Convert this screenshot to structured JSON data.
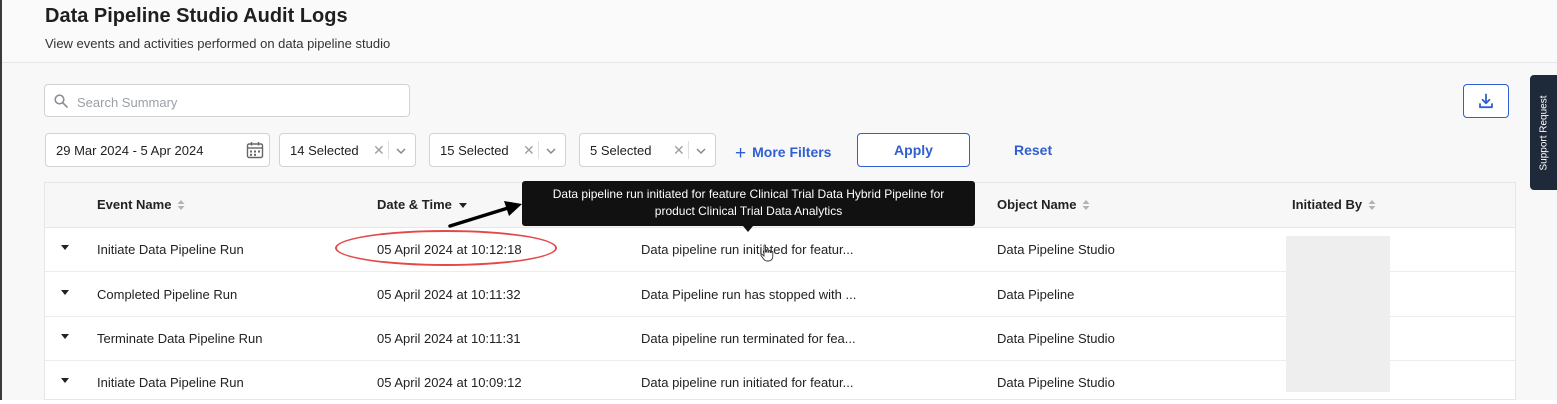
{
  "header": {
    "title": "Data Pipeline Studio Audit Logs",
    "subtitle": "View events and activities performed on data pipeline studio"
  },
  "search": {
    "placeholder": "Search Summary",
    "value": ""
  },
  "filters": {
    "date_range": "29 Mar 2024 - 5 Apr 2024",
    "dropdowns": [
      {
        "label": "14 Selected"
      },
      {
        "label": "15 Selected"
      },
      {
        "label": "5 Selected"
      }
    ],
    "more_filters": "More Filters",
    "apply": "Apply",
    "reset": "Reset"
  },
  "support_tab": "Support Request",
  "table": {
    "columns": {
      "event_name": "Event Name",
      "date_time": "Date & Time",
      "object_name": "Object Name",
      "initiated_by": "Initiated By"
    },
    "rows": [
      {
        "event": "Initiate Data Pipeline Run",
        "datetime": "05 April 2024 at 10:12:18",
        "summary": "Data pipeline run initiated for featur...",
        "object": "Data Pipeline Studio"
      },
      {
        "event": "Completed Pipeline Run",
        "datetime": "05 April 2024 at 10:11:32",
        "summary": "Data Pipeline run has stopped with ...",
        "object": "Data Pipeline"
      },
      {
        "event": "Terminate Data Pipeline Run",
        "datetime": "05 April 2024 at 10:11:31",
        "summary": "Data pipeline run terminated for fea...",
        "object": "Data Pipeline Studio"
      },
      {
        "event": "Initiate Data Pipeline Run",
        "datetime": "05 April 2024 at 10:09:12",
        "summary": "Data pipeline run initiated for featur...",
        "object": "Data Pipeline Studio"
      }
    ]
  },
  "tooltip": {
    "line1": "Data pipeline run initiated for feature Clinical Trial Data Hybrid Pipeline for",
    "line2": "product Clinical Trial Data Analytics"
  },
  "colors": {
    "accent": "#2f5fd0",
    "annotation": "#e24a4a",
    "tooltip_bg": "#111111"
  }
}
